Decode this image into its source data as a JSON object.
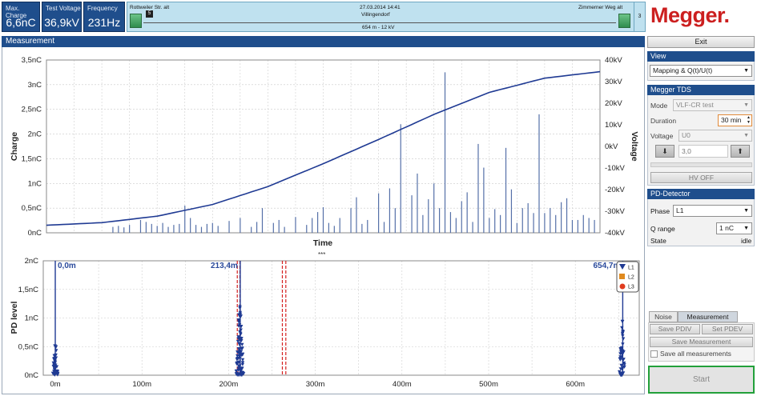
{
  "status": {
    "max_charge": {
      "label": "Max. Charge",
      "value": "6,6nC"
    },
    "test_voltage": {
      "label": "Test Voltage",
      "value": "36,9kV"
    },
    "frequency": {
      "label": "Frequency",
      "value": "231Hz"
    }
  },
  "cable": {
    "start_name": "Rottweiler Str. alt",
    "datetime": "27.03.2014 14:41",
    "location": "Villingendorf",
    "end_name": "Zimmerner Weg alt",
    "start_marker": "5",
    "info": "654 m - 12 kV",
    "count": "3"
  },
  "brand": {
    "logo_text": "Megger.",
    "color": "#cc1f1f"
  },
  "measurement": {
    "header": "Measurement",
    "separator": "***"
  },
  "chart_data": [
    {
      "type": "line",
      "xlabel": "Time",
      "ylabel": "Charge",
      "y2label": "Voltage",
      "y_ticks": [
        "0nC",
        "0,5nC",
        "1nC",
        "1,5nC",
        "2nC",
        "2,5nC",
        "3nC",
        "3,5nC"
      ],
      "y2_ticks": [
        "-40kV",
        "-30kV",
        "-20kV",
        "-10kV",
        "0kV",
        "10kV",
        "20kV",
        "30kV",
        "40kV"
      ],
      "ylim": [
        0,
        3.5
      ],
      "y2lim": [
        -40,
        40
      ],
      "grid": true,
      "voltage_curve": {
        "x": [
          0,
          0.1,
          0.2,
          0.3,
          0.4,
          0.5,
          0.6,
          0.7,
          0.8,
          0.9,
          1.0
        ],
        "values": [
          -36.5,
          -35.3,
          -32.3,
          -26.9,
          -18.6,
          -8.0,
          3.2,
          14.8,
          25.0,
          31.6,
          34.6
        ]
      },
      "pd_pulses": {
        "x": [
          0.12,
          0.13,
          0.14,
          0.15,
          0.17,
          0.18,
          0.19,
          0.2,
          0.21,
          0.22,
          0.23,
          0.24,
          0.25,
          0.26,
          0.27,
          0.28,
          0.29,
          0.3,
          0.31,
          0.33,
          0.35,
          0.37,
          0.38,
          0.39,
          0.41,
          0.42,
          0.43,
          0.45,
          0.47,
          0.48,
          0.49,
          0.5,
          0.51,
          0.52,
          0.53,
          0.55,
          0.56,
          0.57,
          0.58,
          0.6,
          0.61,
          0.62,
          0.63,
          0.64,
          0.66,
          0.67,
          0.68,
          0.69,
          0.7,
          0.71,
          0.72,
          0.73,
          0.74,
          0.75,
          0.76,
          0.77,
          0.78,
          0.79,
          0.8,
          0.81,
          0.82,
          0.83,
          0.84,
          0.85,
          0.86,
          0.87,
          0.88,
          0.89,
          0.9,
          0.91,
          0.92,
          0.93,
          0.94,
          0.95,
          0.96,
          0.97,
          0.98,
          0.99
        ],
        "values": [
          0.12,
          0.14,
          0.11,
          0.16,
          0.26,
          0.22,
          0.18,
          0.14,
          0.2,
          0.12,
          0.16,
          0.18,
          0.55,
          0.3,
          0.16,
          0.12,
          0.18,
          0.2,
          0.14,
          0.24,
          0.3,
          0.12,
          0.22,
          0.5,
          0.2,
          0.26,
          0.12,
          0.32,
          0.16,
          0.3,
          0.42,
          0.52,
          0.2,
          0.14,
          0.3,
          0.5,
          0.72,
          0.18,
          0.26,
          0.8,
          0.22,
          0.9,
          0.5,
          2.2,
          0.76,
          1.2,
          0.36,
          0.68,
          1.0,
          0.5,
          3.25,
          0.42,
          0.3,
          0.64,
          0.82,
          0.22,
          1.8,
          1.32,
          0.3,
          0.48,
          0.36,
          1.72,
          0.88,
          0.2,
          0.5,
          0.6,
          0.4,
          2.4,
          0.4,
          0.5,
          0.36,
          0.62,
          0.7,
          0.26,
          0.26,
          0.36,
          0.3,
          0.26
        ]
      }
    },
    {
      "type": "scatter",
      "ylabel": "PD level",
      "x_ticks": [
        "0m",
        "100m",
        "200m",
        "300m",
        "400m",
        "500m",
        "600m"
      ],
      "y_ticks": [
        "0nC",
        "0,5nC",
        "1nC",
        "1,5nC",
        "2nC"
      ],
      "xlim": [
        0,
        660
      ],
      "ylim": [
        0,
        2
      ],
      "grid": true,
      "cursor_labels": [
        "0,0m",
        "213,4m",
        "654,7m"
      ],
      "cursor_positions_m": [
        0,
        213.4,
        654.7
      ],
      "red_markers_m": [
        210,
        213,
        262,
        266
      ],
      "clusters": [
        {
          "x_m": 0,
          "max_nC": 0.55
        },
        {
          "x_m": 213,
          "max_nC": 1.25
        },
        {
          "x_m": 654,
          "max_nC": 1.0
        }
      ],
      "legend": [
        "L1",
        "L2",
        "L3"
      ],
      "legend_colors": [
        "#1f3a93",
        "#e08a1e",
        "#e03c1f"
      ]
    }
  ],
  "panel": {
    "exit_label": "Exit",
    "view": {
      "header": "View",
      "selected": "Mapping & Q(t)/U(t)"
    },
    "tds": {
      "header": "Megger TDS",
      "mode_label": "Mode",
      "mode_value": "VLF-CR test",
      "duration_label": "Duration",
      "duration_value": "30 min",
      "voltage_label": "Voltage",
      "voltage_value": "U0",
      "voltage_reading": "3,0",
      "hv_off_label": "HV OFF"
    },
    "pd": {
      "header": "PD-Detector",
      "phase_label": "Phase",
      "phase_value": "L1",
      "qrange_label": "Q range",
      "qrange_value": "1 nC",
      "state_label": "State",
      "state_value": "idle"
    },
    "tabs": {
      "noise": "Noise",
      "measurement": "Measurement"
    },
    "save_pdiv": "Save PDIV",
    "set_pdev": "Set PDEV",
    "save_measurement": "Save Measurement",
    "save_all": "Save all measurements",
    "start": "Start"
  }
}
